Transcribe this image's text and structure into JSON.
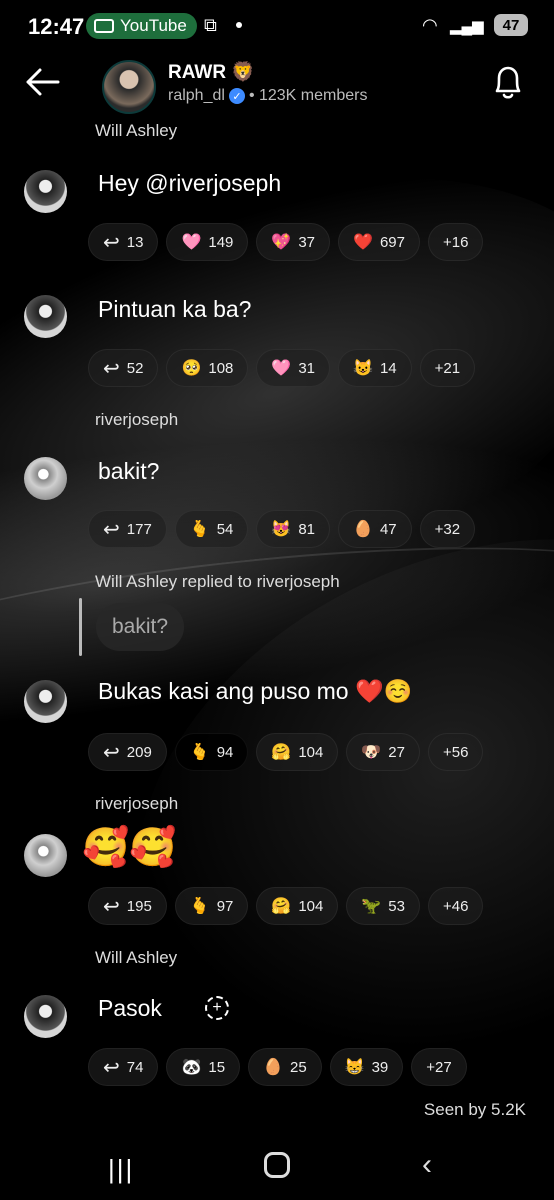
{
  "status_bar": {
    "time": "12:47",
    "app_pill": "YouTube",
    "battery": "47"
  },
  "header": {
    "channel_name": "RAWR 🦁",
    "handle": "ralph_dl",
    "members": "• 123K members"
  },
  "messages": [
    {
      "sender": "Will Ashley",
      "text": "Hey @riverjoseph",
      "reactions": [
        {
          "icon": "reply-icon",
          "emoji": "↩",
          "count": "13"
        },
        {
          "icon": "pink-heart-icon",
          "emoji": "🩷",
          "count": "149"
        },
        {
          "icon": "sparkling-heart-icon",
          "emoji": "💖",
          "count": "37"
        },
        {
          "icon": "red-heart-icon",
          "emoji": "❤️",
          "count": "697"
        },
        {
          "icon": "more",
          "emoji": "",
          "count": "+16"
        }
      ]
    },
    {
      "sender": "",
      "text": "Pintuan ka ba?",
      "reactions": [
        {
          "icon": "reply-icon",
          "emoji": "↩",
          "count": "52"
        },
        {
          "icon": "pleading-face-icon",
          "emoji": "🥺",
          "count": "108"
        },
        {
          "icon": "pink-heart-icon",
          "emoji": "🩷",
          "count": "31"
        },
        {
          "icon": "cat-face-icon",
          "emoji": "😺",
          "count": "14"
        },
        {
          "icon": "more",
          "emoji": "",
          "count": "+21"
        }
      ]
    },
    {
      "sender": "riverjoseph",
      "text": "bakit?",
      "reactions": [
        {
          "icon": "reply-icon",
          "emoji": "↩",
          "count": "177"
        },
        {
          "icon": "hand-icon",
          "emoji": "🫰",
          "count": "54"
        },
        {
          "icon": "heart-eyes-cat-icon",
          "emoji": "😻",
          "count": "81"
        },
        {
          "icon": "egg-icon",
          "emoji": "🥚",
          "count": "47"
        },
        {
          "icon": "more",
          "emoji": "",
          "count": "+32"
        }
      ]
    },
    {
      "sender": "Will Ashley replied to riverjoseph",
      "quoted": "bakit?",
      "text": "Bukas kasi ang puso mo ❤️☺️",
      "reactions": [
        {
          "icon": "reply-icon",
          "emoji": "↩",
          "count": "209"
        },
        {
          "icon": "hand-icon",
          "emoji": "🫰",
          "count": "94"
        },
        {
          "icon": "hugging-face-icon",
          "emoji": "🤗",
          "count": "104"
        },
        {
          "icon": "dog-face-icon",
          "emoji": "🐶",
          "count": "27"
        },
        {
          "icon": "more",
          "emoji": "",
          "count": "+56"
        }
      ]
    },
    {
      "sender": "riverjoseph",
      "text": "🥰🥰",
      "reactions": [
        {
          "icon": "reply-icon",
          "emoji": "↩",
          "count": "195"
        },
        {
          "icon": "hand-icon",
          "emoji": "🫰",
          "count": "97"
        },
        {
          "icon": "hugging-face-icon",
          "emoji": "🤗",
          "count": "104"
        },
        {
          "icon": "dinosaur-icon",
          "emoji": "🦖",
          "count": "53"
        },
        {
          "icon": "more",
          "emoji": "",
          "count": "+46"
        }
      ]
    },
    {
      "sender": "Will Ashley",
      "text": "Pasok",
      "reactions": [
        {
          "icon": "reply-icon",
          "emoji": "↩",
          "count": "74"
        },
        {
          "icon": "panda-icon",
          "emoji": "🐼",
          "count": "15"
        },
        {
          "icon": "egg-icon",
          "emoji": "🥚",
          "count": "25"
        },
        {
          "icon": "smiling-cat-icon",
          "emoji": "😸",
          "count": "39"
        },
        {
          "icon": "more",
          "emoji": "",
          "count": "+27"
        }
      ]
    }
  ],
  "footer": {
    "seen": "Seen by 5.2K"
  },
  "colors": {
    "background": "#000000",
    "youtube_pill": "#1e6e3c",
    "verified": "#3d8bff"
  }
}
